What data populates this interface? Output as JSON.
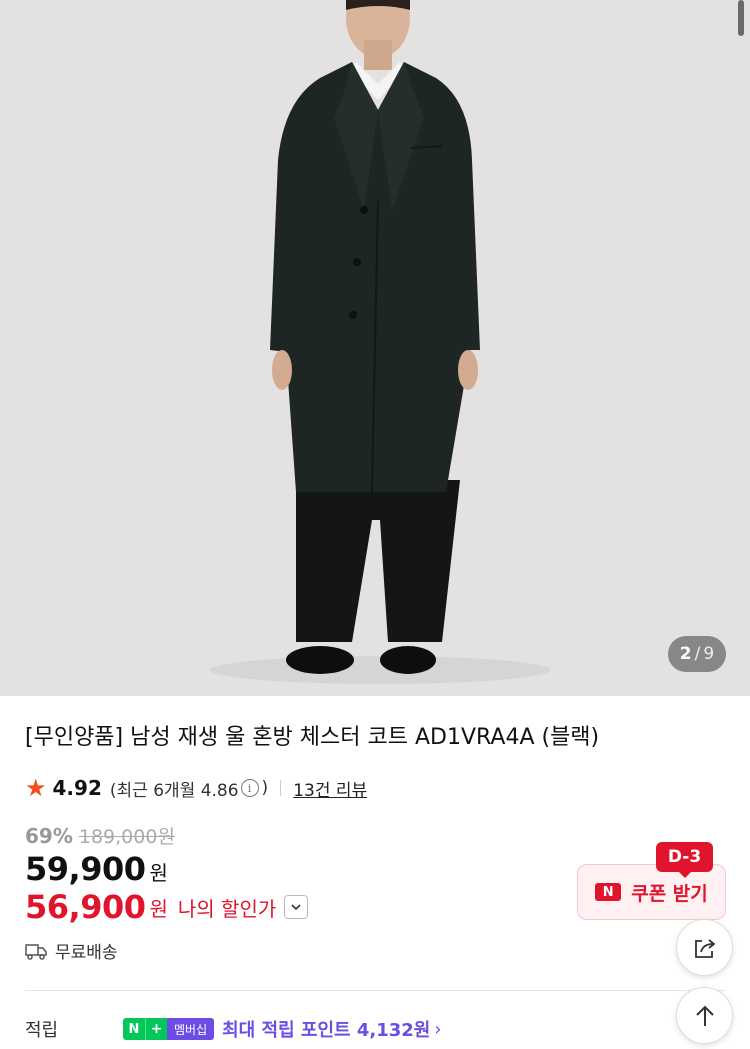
{
  "gallery": {
    "image_alt": "",
    "current_page": "2",
    "separator": "/",
    "total_pages": "9"
  },
  "product": {
    "title": "[무인양품] 남성 재생 울 혼방 체스터 코트 AD1VRA4A (블랙)",
    "rating": "4.92",
    "recent_rating_text": "(최근 6개월 4.86",
    "recent_rating_close": ")",
    "review_link": "13건 리뷰",
    "discount_rate": "69%",
    "original_price": "189,000원",
    "price": "59,900",
    "price_unit": "원",
    "my_price": "56,900",
    "my_price_unit": "원",
    "my_price_label": "나의 할인가",
    "shipping": "무료배송"
  },
  "coupon": {
    "dday": "D-3",
    "icon_label": "N",
    "label": "쿠폰 받기"
  },
  "points": {
    "label": "적립",
    "badge_n": "N",
    "badge_plus": "+",
    "badge_text": "멤버십",
    "text": "최대 적립 포인트 4,132원",
    "chevron": "›"
  },
  "colors": {
    "accent_red": "#e0142c",
    "star": "#f24e1e",
    "npay_green": "#03c75a",
    "membership_purple": "#6b4de6"
  },
  "icons": {
    "star": "star-icon",
    "info": "info-icon",
    "chevron_down": "chevron-down-icon",
    "truck": "truck-icon",
    "share": "share-icon",
    "arrow_up": "arrow-up-icon"
  }
}
